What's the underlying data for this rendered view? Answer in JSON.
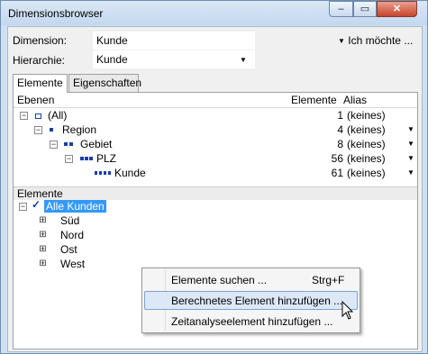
{
  "window": {
    "title": "Dimensionsbrowser",
    "caption_minimize": "–",
    "caption_maximize": "▭",
    "caption_close": "✕"
  },
  "form": {
    "dimension_label": "Dimension:",
    "dimension_value": "Kunde",
    "hierarchy_label": "Hierarchie:",
    "hierarchy_value": "Kunde",
    "options_label": "Ich möchte ..."
  },
  "tabs": [
    {
      "label": "Elemente",
      "active": true
    },
    {
      "label": "Eigenschaften",
      "active": false
    }
  ],
  "levels": {
    "col_levels": "Ebenen",
    "col_elements": "Elemente",
    "col_alias": "Alias",
    "rows": [
      {
        "name": "(All)",
        "count": "1",
        "alias": "(keines)",
        "dropdown": false
      },
      {
        "name": "Region",
        "count": "4",
        "alias": "(keines)",
        "dropdown": true
      },
      {
        "name": "Gebiet",
        "count": "8",
        "alias": "(keines)",
        "dropdown": true
      },
      {
        "name": "PLZ",
        "count": "56",
        "alias": "(keines)",
        "dropdown": true
      },
      {
        "name": "Kunde",
        "count": "61",
        "alias": "(keines)",
        "dropdown": true
      }
    ]
  },
  "elements": {
    "header": "Elemente",
    "root": "Alle Kunden",
    "children": [
      "Süd",
      "Nord",
      "Ost",
      "West"
    ]
  },
  "context_menu": {
    "items": [
      {
        "label": "Elemente suchen ...",
        "shortcut": "Strg+F",
        "highlighted": false
      },
      {
        "label": "Berechnetes Element hinzufügen ...",
        "shortcut": "",
        "highlighted": true
      },
      {
        "label": "Zeitanalyseelement hinzufügen ...",
        "shortcut": "",
        "highlighted": false
      }
    ]
  },
  "colors": {
    "selection": "#3399ff",
    "menu_highlight": "#dce8f8",
    "level_icon": "#1a3ea8",
    "close_button": "#c7432a"
  }
}
